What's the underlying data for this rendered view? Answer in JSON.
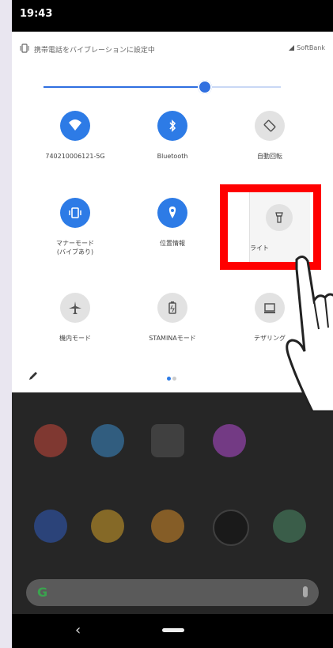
{
  "status_bar": {
    "time": "19:43"
  },
  "quick_settings": {
    "vibration_text": "携帯電話をバイブレーションに設定中",
    "carrier": "SoftBank",
    "brightness_fraction": 0.68,
    "tiles": [
      {
        "label": "740210006121-5G",
        "icon": "wifi-icon",
        "state": "on"
      },
      {
        "label": "Bluetooth",
        "icon": "bluetooth-icon",
        "state": "on"
      },
      {
        "label": "自動回転",
        "icon": "auto-rotate-icon",
        "state": "off"
      },
      {
        "label": "マナーモード\n(バイブあり)",
        "icon": "vibrate-icon",
        "state": "on"
      },
      {
        "label": "位置情報",
        "icon": "location-icon",
        "state": "on"
      },
      {
        "label": "ライト",
        "icon": "flashlight-icon",
        "state": "off"
      },
      {
        "label": "機内モード",
        "icon": "airplane-icon",
        "state": "off"
      },
      {
        "label": "STAMINAモード",
        "icon": "battery-icon",
        "state": "off"
      },
      {
        "label": "テザリング",
        "icon": "tethering-icon",
        "state": "off"
      }
    ]
  },
  "colors": {
    "accent": "#2d7be6",
    "highlight": "#ff0000"
  },
  "home_apps": [
    "gmail-icon",
    "play-store-icon",
    "app-icon",
    "photos-icon",
    "messages-icon",
    "chrome-icon",
    "email-icon",
    "camera-icon",
    "calculator-icon"
  ]
}
